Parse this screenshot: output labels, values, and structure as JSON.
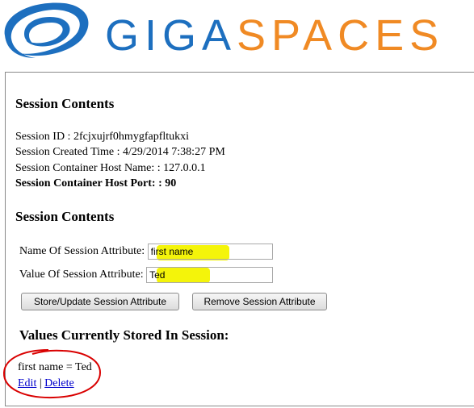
{
  "brand": {
    "word_part1": "GIGA",
    "word_part2": "SPACES",
    "color_primary": "#1d6fbf",
    "color_secondary": "#f08a24"
  },
  "session": {
    "heading": "Session Contents",
    "id_line": "Session ID : 2fcjxujrf0hmygfapfltukxi",
    "created_line": "Session Created Time : 4/29/2014 7:38:27 PM",
    "host_name_line": "Session Container Host Name: : 127.0.0.1",
    "host_port_line": "Session Container Host Port: : 90"
  },
  "form": {
    "heading": "Session Contents",
    "name_label": "Name Of Session Attribute:",
    "name_value": "first name",
    "value_label": "Value Of Session Attribute:",
    "value_value": "Ted",
    "store_button": "Store/Update Session Attribute",
    "remove_button": "Remove Session Attribute"
  },
  "stored": {
    "heading": "Values Currently Stored In Session:",
    "items": [
      {
        "text": "first name = Ted",
        "edit": "Edit",
        "separator": "|",
        "delete": "Delete"
      }
    ]
  },
  "annotation_color": "#d90000",
  "highlight_color": "#f4f40a"
}
